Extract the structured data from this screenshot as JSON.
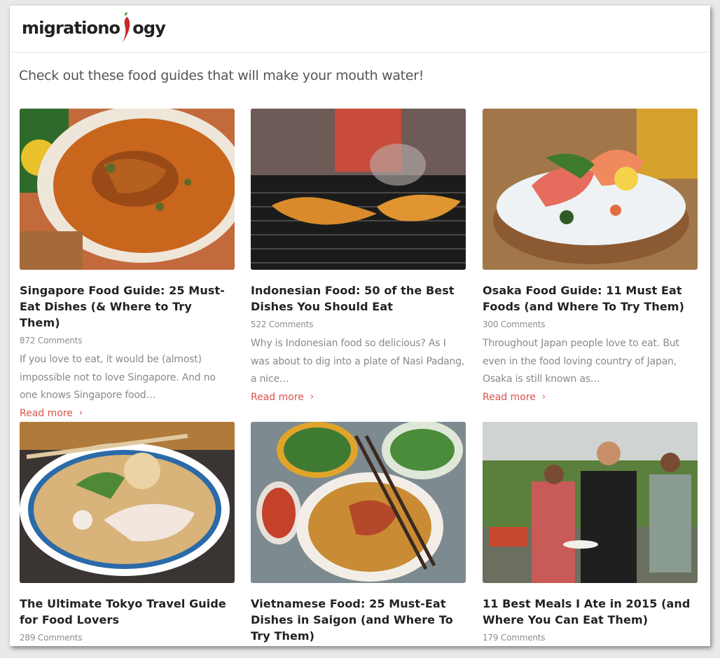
{
  "header": {
    "logo_left": "migrationo",
    "logo_right": "ogy"
  },
  "intro": "Check out these food guides that will make your mouth water!",
  "read_more_label": "Read more",
  "cards": [
    {
      "title": "Singapore Food Guide: 25 Must-Eat Dishes (& Where to Try Them)",
      "comments": "872 Comments",
      "excerpt": "If you love to eat, it would be (almost) impossible not to love Singapore. And no one knows Singapore food…",
      "image": "singapore-fish-curry-image"
    },
    {
      "title": "Indonesian Food: 50 of the Best Dishes You Should Eat",
      "comments": "522 Comments",
      "excerpt": "Why is Indonesian food so delicious? As I was about to dig into a plate of Nasi Padang, a nice…",
      "image": "indonesian-grilled-chicken-image"
    },
    {
      "title": "Osaka Food Guide: 11 Must Eat Foods (and Where To Try Them)",
      "comments": "300 Comments",
      "excerpt": "Throughout Japan people love to eat. But even in the food loving country of Japan, Osaka is still known as…",
      "image": "osaka-sashimi-image"
    },
    {
      "title": "The Ultimate Tokyo Travel Guide for Food Lovers",
      "comments": "289 Comments",
      "image": "tokyo-ramen-image"
    },
    {
      "title": "Vietnamese Food: 25 Must-Eat Dishes in Saigon (and Where To Try Them)",
      "comments": "",
      "image": "vietnamese-noodle-soup-image"
    },
    {
      "title": "11 Best Meals I Ate in 2015 (and Where You Can Eat Them)",
      "comments": "179 Comments",
      "image": "market-people-image"
    }
  ],
  "colors": {
    "accent": "#d9534f",
    "title": "#222222",
    "meta": "#8d8d8d"
  }
}
